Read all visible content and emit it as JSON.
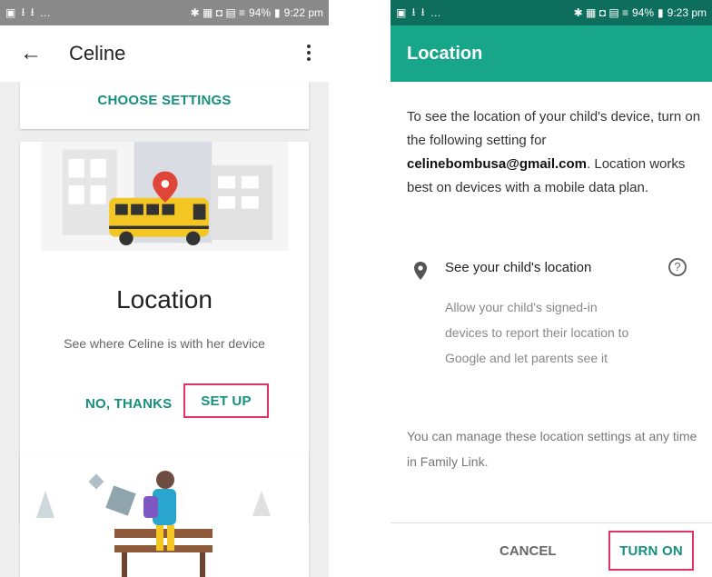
{
  "left": {
    "status": {
      "time": "9:22 pm",
      "battery": "94%"
    },
    "header": {
      "title": "Celine"
    },
    "cards": {
      "choose_settings": "CHOOSE SETTINGS",
      "location_title": "Location",
      "location_subtitle": "See where Celine is with her device",
      "no_thanks": "NO, THANKS",
      "set_up": "SET UP"
    }
  },
  "right": {
    "status": {
      "time": "9:23 pm",
      "battery": "94%"
    },
    "header": {
      "title": "Location"
    },
    "intro_1": "To see the location of your child's device, turn on the following setting for",
    "email": "celinebombusa@gmail.com",
    "intro_2": ". Location works best on devices with a mobile data plan.",
    "setting": {
      "title": "See your child's location",
      "help": "?",
      "description": "Allow your child's signed-in devices to report their location to Google and let parents see it"
    },
    "manage": "You can manage these location settings at any time in Family Link.",
    "buttons": {
      "cancel": "CANCEL",
      "turn_on": "TURN ON"
    }
  },
  "colors": {
    "accent": "#17a689",
    "accent_dark": "#0d6e5d",
    "highlight": "#e13366",
    "bus": "#f3c623"
  },
  "icons": [
    "back-arrow-icon",
    "more-vert-icon",
    "location-pin-icon",
    "help-icon"
  ]
}
